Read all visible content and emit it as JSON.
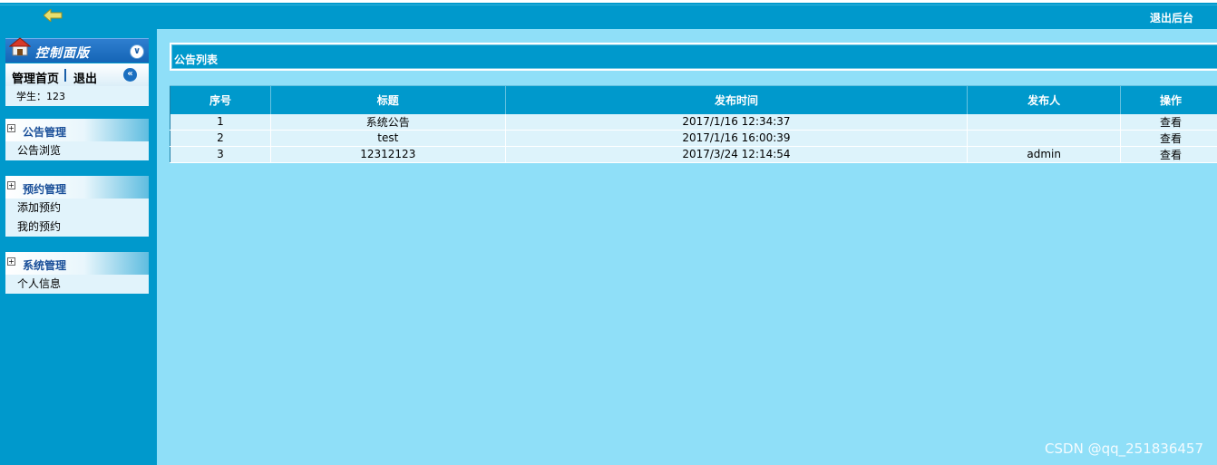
{
  "topbar": {
    "logout_label": "退出后台"
  },
  "sidebar": {
    "panel_title": "控制面版",
    "home_link": "管理首页",
    "exit_link": "退出",
    "user_info": "学生：123",
    "groups": [
      {
        "title": "公告管理",
        "items": [
          "公告浏览"
        ]
      },
      {
        "title": "预约管理",
        "items": [
          "添加预约",
          "我的预约"
        ]
      },
      {
        "title": "系统管理",
        "items": [
          "个人信息"
        ]
      }
    ]
  },
  "main": {
    "list_title": "公告列表",
    "columns": [
      "序号",
      "标题",
      "发布时间",
      "发布人",
      "操作"
    ],
    "rows": [
      [
        "1",
        "系统公告",
        "2017/1/16 12:34:37",
        "",
        "查看"
      ],
      [
        "2",
        "test",
        "2017/1/16 16:00:39",
        "",
        "查看"
      ],
      [
        "3",
        "12312123",
        "2017/3/24 12:14:54",
        "admin",
        "查看"
      ]
    ]
  },
  "watermark": "CSDN @qq_251836457",
  "colors": {
    "primary": "#0099cc",
    "background": "#8fdff8",
    "row_bg": "#ddf3fb",
    "group_title": "#1a4f99"
  }
}
